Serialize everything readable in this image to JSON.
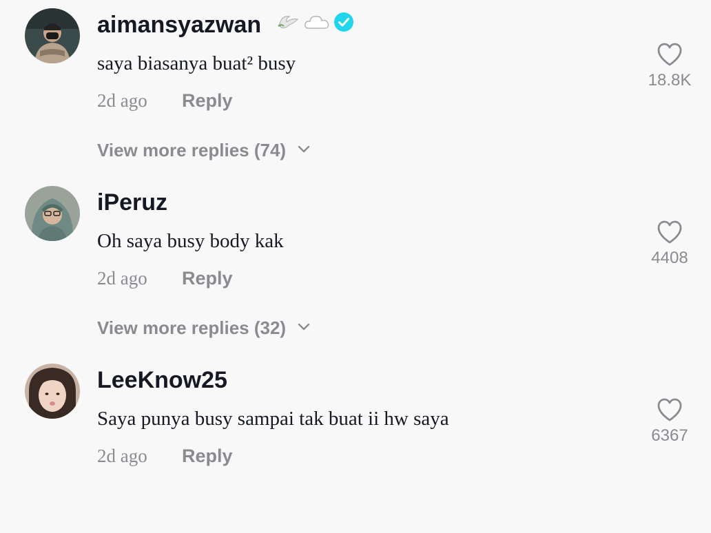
{
  "comments": [
    {
      "username": "aimansyazwan",
      "badges": [
        "dove-emoji",
        "cloud-emoji",
        "verified-badge"
      ],
      "text": "saya biasanya buat² busy",
      "timestamp": "2d ago",
      "reply_label": "Reply",
      "like_count": "18.8K",
      "view_replies": "View more replies (74)"
    },
    {
      "username": "iPeruz",
      "badges": [],
      "text": "Oh saya busy body kak",
      "timestamp": "2d ago",
      "reply_label": "Reply",
      "like_count": "4408",
      "view_replies": "View more replies (32)"
    },
    {
      "username": "LeeKnow25",
      "badges": [],
      "text": "Saya punya busy sampai tak buat ii hw saya",
      "timestamp": "2d ago",
      "reply_label": "Reply",
      "like_count": "6367"
    }
  ],
  "colors": {
    "background": "#f8f8f8",
    "primary_text": "#161823",
    "secondary_text": "#8a8b91",
    "verified_badge": "#20d5ec"
  }
}
